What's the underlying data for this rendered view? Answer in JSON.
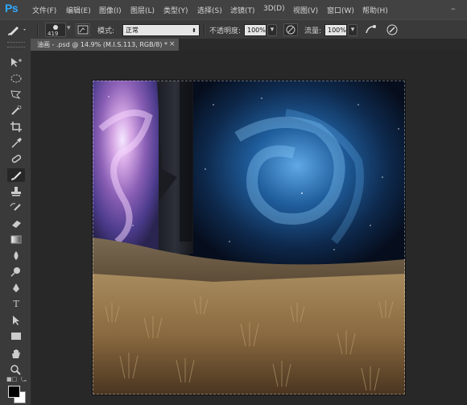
{
  "app": {
    "logo": "Ps"
  },
  "menu": [
    {
      "key": "file",
      "label": "文件(F)"
    },
    {
      "key": "edit",
      "label": "编辑(E)"
    },
    {
      "key": "image",
      "label": "图像(I)"
    },
    {
      "key": "layer",
      "label": "图层(L)"
    },
    {
      "key": "type",
      "label": "类型(Y)"
    },
    {
      "key": "select",
      "label": "选择(S)"
    },
    {
      "key": "filter",
      "label": "滤镜(T)"
    },
    {
      "key": "3d",
      "label": "3D(D)"
    },
    {
      "key": "view",
      "label": "视图(V)"
    },
    {
      "key": "window",
      "label": "窗口(W)"
    },
    {
      "key": "help",
      "label": "帮助(H)"
    }
  ],
  "options": {
    "brush_size": "419",
    "mode_label": "模式:",
    "mode_value": "正常",
    "opacity_label": "不透明度:",
    "opacity_value": "100%",
    "flow_label": "流量:",
    "flow_value": "100%"
  },
  "document_tab": {
    "title": "油画 - .psd @ 14.9% (M.I.S.113, RGB/8) *",
    "close": "×"
  },
  "tools": [
    {
      "key": "move",
      "icon": "move-icon"
    },
    {
      "key": "marquee",
      "icon": "elliptical-marquee-icon"
    },
    {
      "key": "lasso",
      "icon": "polygonal-lasso-icon"
    },
    {
      "key": "quick-select",
      "icon": "quick-selection-icon"
    },
    {
      "key": "crop",
      "icon": "crop-icon"
    },
    {
      "key": "eyedropper",
      "icon": "eyedropper-icon"
    },
    {
      "key": "healing",
      "icon": "healing-brush-icon"
    },
    {
      "key": "brush",
      "icon": "brush-icon",
      "active": true
    },
    {
      "key": "stamp",
      "icon": "clone-stamp-icon"
    },
    {
      "key": "history-brush",
      "icon": "history-brush-icon"
    },
    {
      "key": "eraser",
      "icon": "eraser-icon"
    },
    {
      "key": "gradient",
      "icon": "gradient-icon"
    },
    {
      "key": "blur",
      "icon": "blur-icon"
    },
    {
      "key": "dodge",
      "icon": "dodge-icon"
    },
    {
      "key": "pen",
      "icon": "pen-icon"
    },
    {
      "key": "type",
      "icon": "type-icon",
      "glyph": "T"
    },
    {
      "key": "path-select",
      "icon": "path-selection-icon"
    },
    {
      "key": "shape",
      "icon": "rectangle-shape-icon"
    },
    {
      "key": "hand",
      "icon": "hand-icon"
    },
    {
      "key": "zoom",
      "icon": "zoom-icon"
    }
  ],
  "colors": {
    "accent": "#31a8ff",
    "foreground": "#000000",
    "background": "#ffffff"
  }
}
